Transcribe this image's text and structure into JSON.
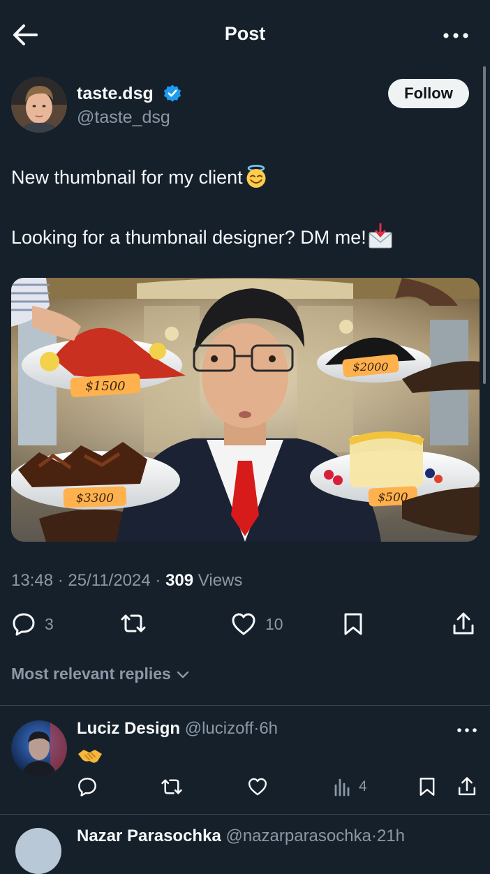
{
  "header": {
    "title": "Post",
    "back_icon": "arrow-left-icon",
    "more_icon": "more-dots-icon"
  },
  "author": {
    "name": "taste.dsg",
    "handle": "@taste_dsg",
    "verified": true,
    "follow_label": "Follow"
  },
  "post": {
    "line1": "New thumbnail for my client",
    "line1_emoji": "smiling-face-with-halo",
    "line2": "Looking for a thumbnail designer? DM me!",
    "line2_emoji": "envelope-with-arrow",
    "image": {
      "price_tags": [
        "$1500",
        "$2000",
        "$3300",
        "$500"
      ]
    },
    "time": "13:48",
    "date": "25/11/2024",
    "views_count": "309",
    "views_label": "Views"
  },
  "actions": {
    "replies": "3",
    "reposts": "",
    "likes": "10"
  },
  "replies_section": {
    "label": "Most relevant replies"
  },
  "replies": [
    {
      "name": "Luciz Design",
      "handle": "@lucizoff",
      "time": "6h",
      "body_emoji": "handshake",
      "views": "4"
    }
  ],
  "next_reply_preview": {
    "name": "Nazar Parasochka",
    "handle": "@nazarparasochka",
    "time": "21h"
  },
  "colors": {
    "background": "#15202b",
    "text": "#f7f9f9",
    "muted": "#8b98a5",
    "verified": "#1d9bf0",
    "follow_bg": "#eff3f4",
    "divider": "#38444d"
  }
}
